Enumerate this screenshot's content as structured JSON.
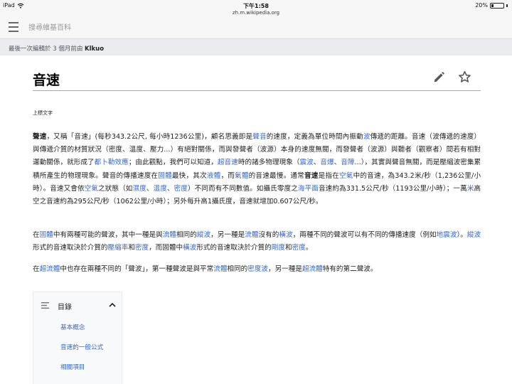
{
  "status_bar": {
    "device": "iPad",
    "time": "下午1:58",
    "url": "zh.m.wikipedia.org",
    "battery": "20%",
    "battery_level": 0.2
  },
  "header": {
    "search_placeholder": "搜尋維基百科"
  },
  "last_edit": {
    "prefix": "最後一次編輯於 3 個月前由",
    "user": "Klkuo"
  },
  "article": {
    "title": "音速",
    "caption": "上標文字",
    "p1": [
      {
        "t": "聲速",
        "b": true
      },
      {
        "t": "，又稱「音速」(每秒343.2公尺, 每小時1236公里)，顧名思義即是"
      },
      {
        "t": "聲音",
        "link": true
      },
      {
        "t": "的速度，定義為單位時間內振動"
      },
      {
        "t": "波",
        "link": true
      },
      {
        "t": "傳遞的距離。音速（波傳遞的速度）與傳遞介質的材質狀況（密度、溫度、壓力...）有絕對關係，而與發聲者（波源）本身的速度無關，而發聲者（波源）與聽者（觀察者）間若有相對運動關係，就形成了"
      },
      {
        "t": "都卜勒效應",
        "link": true
      },
      {
        "t": "；由此觀點，我們可以知道，"
      },
      {
        "t": "超音速",
        "link": true
      },
      {
        "t": "時的諸多物理現象（"
      },
      {
        "t": "震波",
        "link": true
      },
      {
        "t": "、"
      },
      {
        "t": "音爆",
        "link": true
      },
      {
        "t": "、"
      },
      {
        "t": "音障",
        "link": true
      },
      {
        "t": "...），其實與聲音無關，而是壓縮波密集累積所產生的物理現象。聲音的傳播速度在"
      },
      {
        "t": "固體",
        "link": true
      },
      {
        "t": "最快，其次"
      },
      {
        "t": "液體",
        "link": true
      },
      {
        "t": "，而"
      },
      {
        "t": "氣體",
        "link": true
      },
      {
        "t": "的音速最慢。通常"
      },
      {
        "t": "音速",
        "b": true
      },
      {
        "t": "是指在"
      },
      {
        "t": "空氣",
        "link": true
      },
      {
        "t": "中的音速，為343.2米/秒（1,236公里/小時）。音速又會依"
      },
      {
        "t": "空氣",
        "link": true
      },
      {
        "t": "之狀態（如"
      },
      {
        "t": "濕度",
        "link": true
      },
      {
        "t": "、"
      },
      {
        "t": "溫度",
        "link": true
      },
      {
        "t": "、"
      },
      {
        "t": "密度",
        "link": true
      },
      {
        "t": "）不同而有不同數值。如攝氏零度之"
      },
      {
        "t": "海平面",
        "link": true
      },
      {
        "t": "音速約為331.5公尺/秒（1193公里/小時）；一萬"
      },
      {
        "t": "米",
        "link": true
      },
      {
        "t": "高空之音速約為295公尺/秒（1062公里/小時）；另外每升高1攝氏度，音速就增加0.607公尺/秒。"
      }
    ],
    "p2": [
      {
        "t": "在"
      },
      {
        "t": "固體",
        "link": true
      },
      {
        "t": "中有兩種可能的聲波，其中一種是與"
      },
      {
        "t": "流體",
        "link": true
      },
      {
        "t": "相同的"
      },
      {
        "t": "縱波",
        "link": true
      },
      {
        "t": "，另一種是"
      },
      {
        "t": "流體",
        "link": true
      },
      {
        "t": "沒有的"
      },
      {
        "t": "橫波",
        "link": true
      },
      {
        "t": "，兩種不同的聲波可以有不同的傳播速度（例如"
      },
      {
        "t": "地震波",
        "link": true
      },
      {
        "t": "）。"
      },
      {
        "t": "縱波",
        "link": true
      },
      {
        "t": "形式的音速取決於介質的"
      },
      {
        "t": "壓縮率",
        "link": true
      },
      {
        "t": "和"
      },
      {
        "t": "密度",
        "link": true
      },
      {
        "t": "，而固體中"
      },
      {
        "t": "橫波",
        "link": true
      },
      {
        "t": "形式的音速取決於介質的"
      },
      {
        "t": "剛度",
        "link": true
      },
      {
        "t": "和"
      },
      {
        "t": "密度",
        "link": true
      },
      {
        "t": "。"
      }
    ],
    "p3": [
      {
        "t": "在"
      },
      {
        "t": "超流體",
        "link": true
      },
      {
        "t": "中也存在兩種不同的「聲波」，第一種聲波是與平常"
      },
      {
        "t": "流體",
        "link": true
      },
      {
        "t": "相同的"
      },
      {
        "t": "密度波",
        "link": true
      },
      {
        "t": "，另一種是"
      },
      {
        "t": "超流體",
        "link": true
      },
      {
        "t": "特有的第二聲波。"
      }
    ]
  },
  "toc": {
    "title": "目錄",
    "items": [
      "基本概念",
      "音速的一般公式",
      "相關項目"
    ]
  },
  "colors": {
    "link": "#3366cc",
    "chrome": "#f7f7f7",
    "lastedit_bg": "#eaecf0"
  }
}
